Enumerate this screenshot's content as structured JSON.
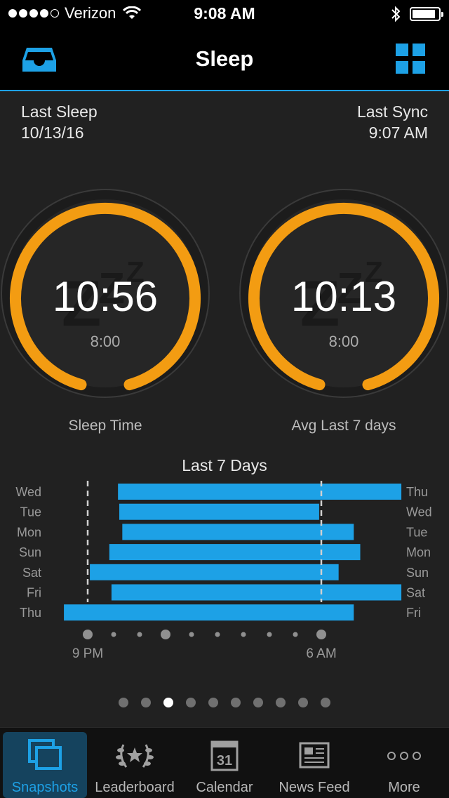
{
  "status_bar": {
    "carrier": "Verizon",
    "time": "9:08 AM",
    "signal_bars": 4,
    "signal_total": 5,
    "battery_fraction": 0.9
  },
  "header": {
    "title": "Sleep"
  },
  "last_sleep": {
    "label": "Last Sleep",
    "date": "10/13/16"
  },
  "last_sync": {
    "label": "Last Sync",
    "time": "9:07 AM"
  },
  "gauges": [
    {
      "value": "10:56",
      "goal": "8:00",
      "label": "Sleep Time"
    },
    {
      "value": "10:13",
      "goal": "8:00",
      "label": "Avg Last 7 days"
    }
  ],
  "colors": {
    "accent": "#1da1e6",
    "gauge": "#f39c12"
  },
  "chart_data": {
    "type": "bar",
    "title": "Last 7 Days",
    "orientation": "horizontal-range",
    "x_tick_labels": [
      "9 PM",
      "6 AM"
    ],
    "x_range": [
      "9 PM",
      "10 AM"
    ],
    "rows": [
      {
        "start_day": "Wed",
        "end_day": "Thu",
        "start": "10:10 PM",
        "end": "9:05 AM"
      },
      {
        "start_day": "Tue",
        "end_day": "Wed",
        "start": "10:13 PM",
        "end": "5:55 AM"
      },
      {
        "start_day": "Mon",
        "end_day": "Tue",
        "start": "10:20 PM",
        "end": "7:15 AM"
      },
      {
        "start_day": "Sun",
        "end_day": "Mon",
        "start": "9:50 PM",
        "end": "7:30 AM"
      },
      {
        "start_day": "Sat",
        "end_day": "Sun",
        "start": "9:05 PM",
        "end": "6:40 AM"
      },
      {
        "start_day": "Fri",
        "end_day": "Sat",
        "start": "9:55 PM",
        "end": "9:05 AM"
      },
      {
        "start_day": "Thu",
        "end_day": "Fri",
        "start": "8:05 PM",
        "end": "7:15 AM"
      }
    ]
  },
  "pager": {
    "count": 10,
    "active_index": 2
  },
  "tabs": [
    {
      "label": "Snapshots",
      "icon": "snapshots-icon",
      "active": true
    },
    {
      "label": "Leaderboard",
      "icon": "laurel-icon",
      "active": false
    },
    {
      "label": "Calendar",
      "icon": "calendar-icon",
      "active": false,
      "badge": "31"
    },
    {
      "label": "News Feed",
      "icon": "newspaper-icon",
      "active": false
    },
    {
      "label": "More",
      "icon": "more-icon",
      "active": false
    }
  ]
}
